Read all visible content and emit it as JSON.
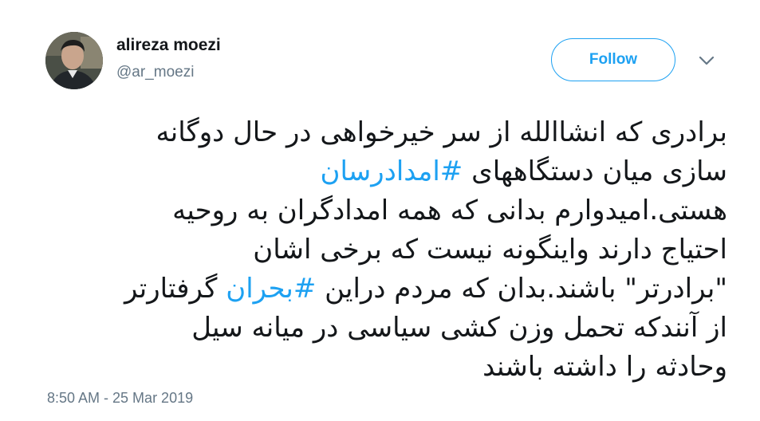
{
  "user": {
    "display_name": "alireza moezi",
    "handle": "@ar_moezi"
  },
  "actions": {
    "follow_label": "Follow",
    "menu_icon": "chevron-down-icon"
  },
  "tweet": {
    "lines": [
      {
        "segments": [
          {
            "text": "برادری که انشاالله از سر خیرخواهی در حال دوگانه",
            "hashtag": false
          }
        ]
      },
      {
        "segments": [
          {
            "text": "سازی میان دستگاههای ",
            "hashtag": false
          },
          {
            "text": "#امدادرسان",
            "hashtag": true
          }
        ]
      },
      {
        "segments": [
          {
            "text": "هستی.امیدوارم بدانی که همه امدادگران به روحیه",
            "hashtag": false
          }
        ]
      },
      {
        "segments": [
          {
            "text": "احتیاج دارند واینگونه نیست که برخی اشان",
            "hashtag": false
          }
        ]
      },
      {
        "segments": [
          {
            "text": "\"برادرتر\" باشند.بدان که مردم دراین ",
            "hashtag": false
          },
          {
            "text": "#بحران",
            "hashtag": true
          },
          {
            "text": " گرفتارتر",
            "hashtag": false
          }
        ]
      },
      {
        "segments": [
          {
            "text": "از آنندکه تحمل وزن کشی سیاسی در میانه سیل",
            "hashtag": false
          }
        ]
      },
      {
        "segments": [
          {
            "text": "وحادثه را داشته باشند",
            "hashtag": false
          }
        ]
      }
    ],
    "timestamp": "8:50 AM - 25 Mar 2019"
  },
  "colors": {
    "accent": "#1da1f2",
    "text": "#14171a",
    "muted": "#657786"
  }
}
